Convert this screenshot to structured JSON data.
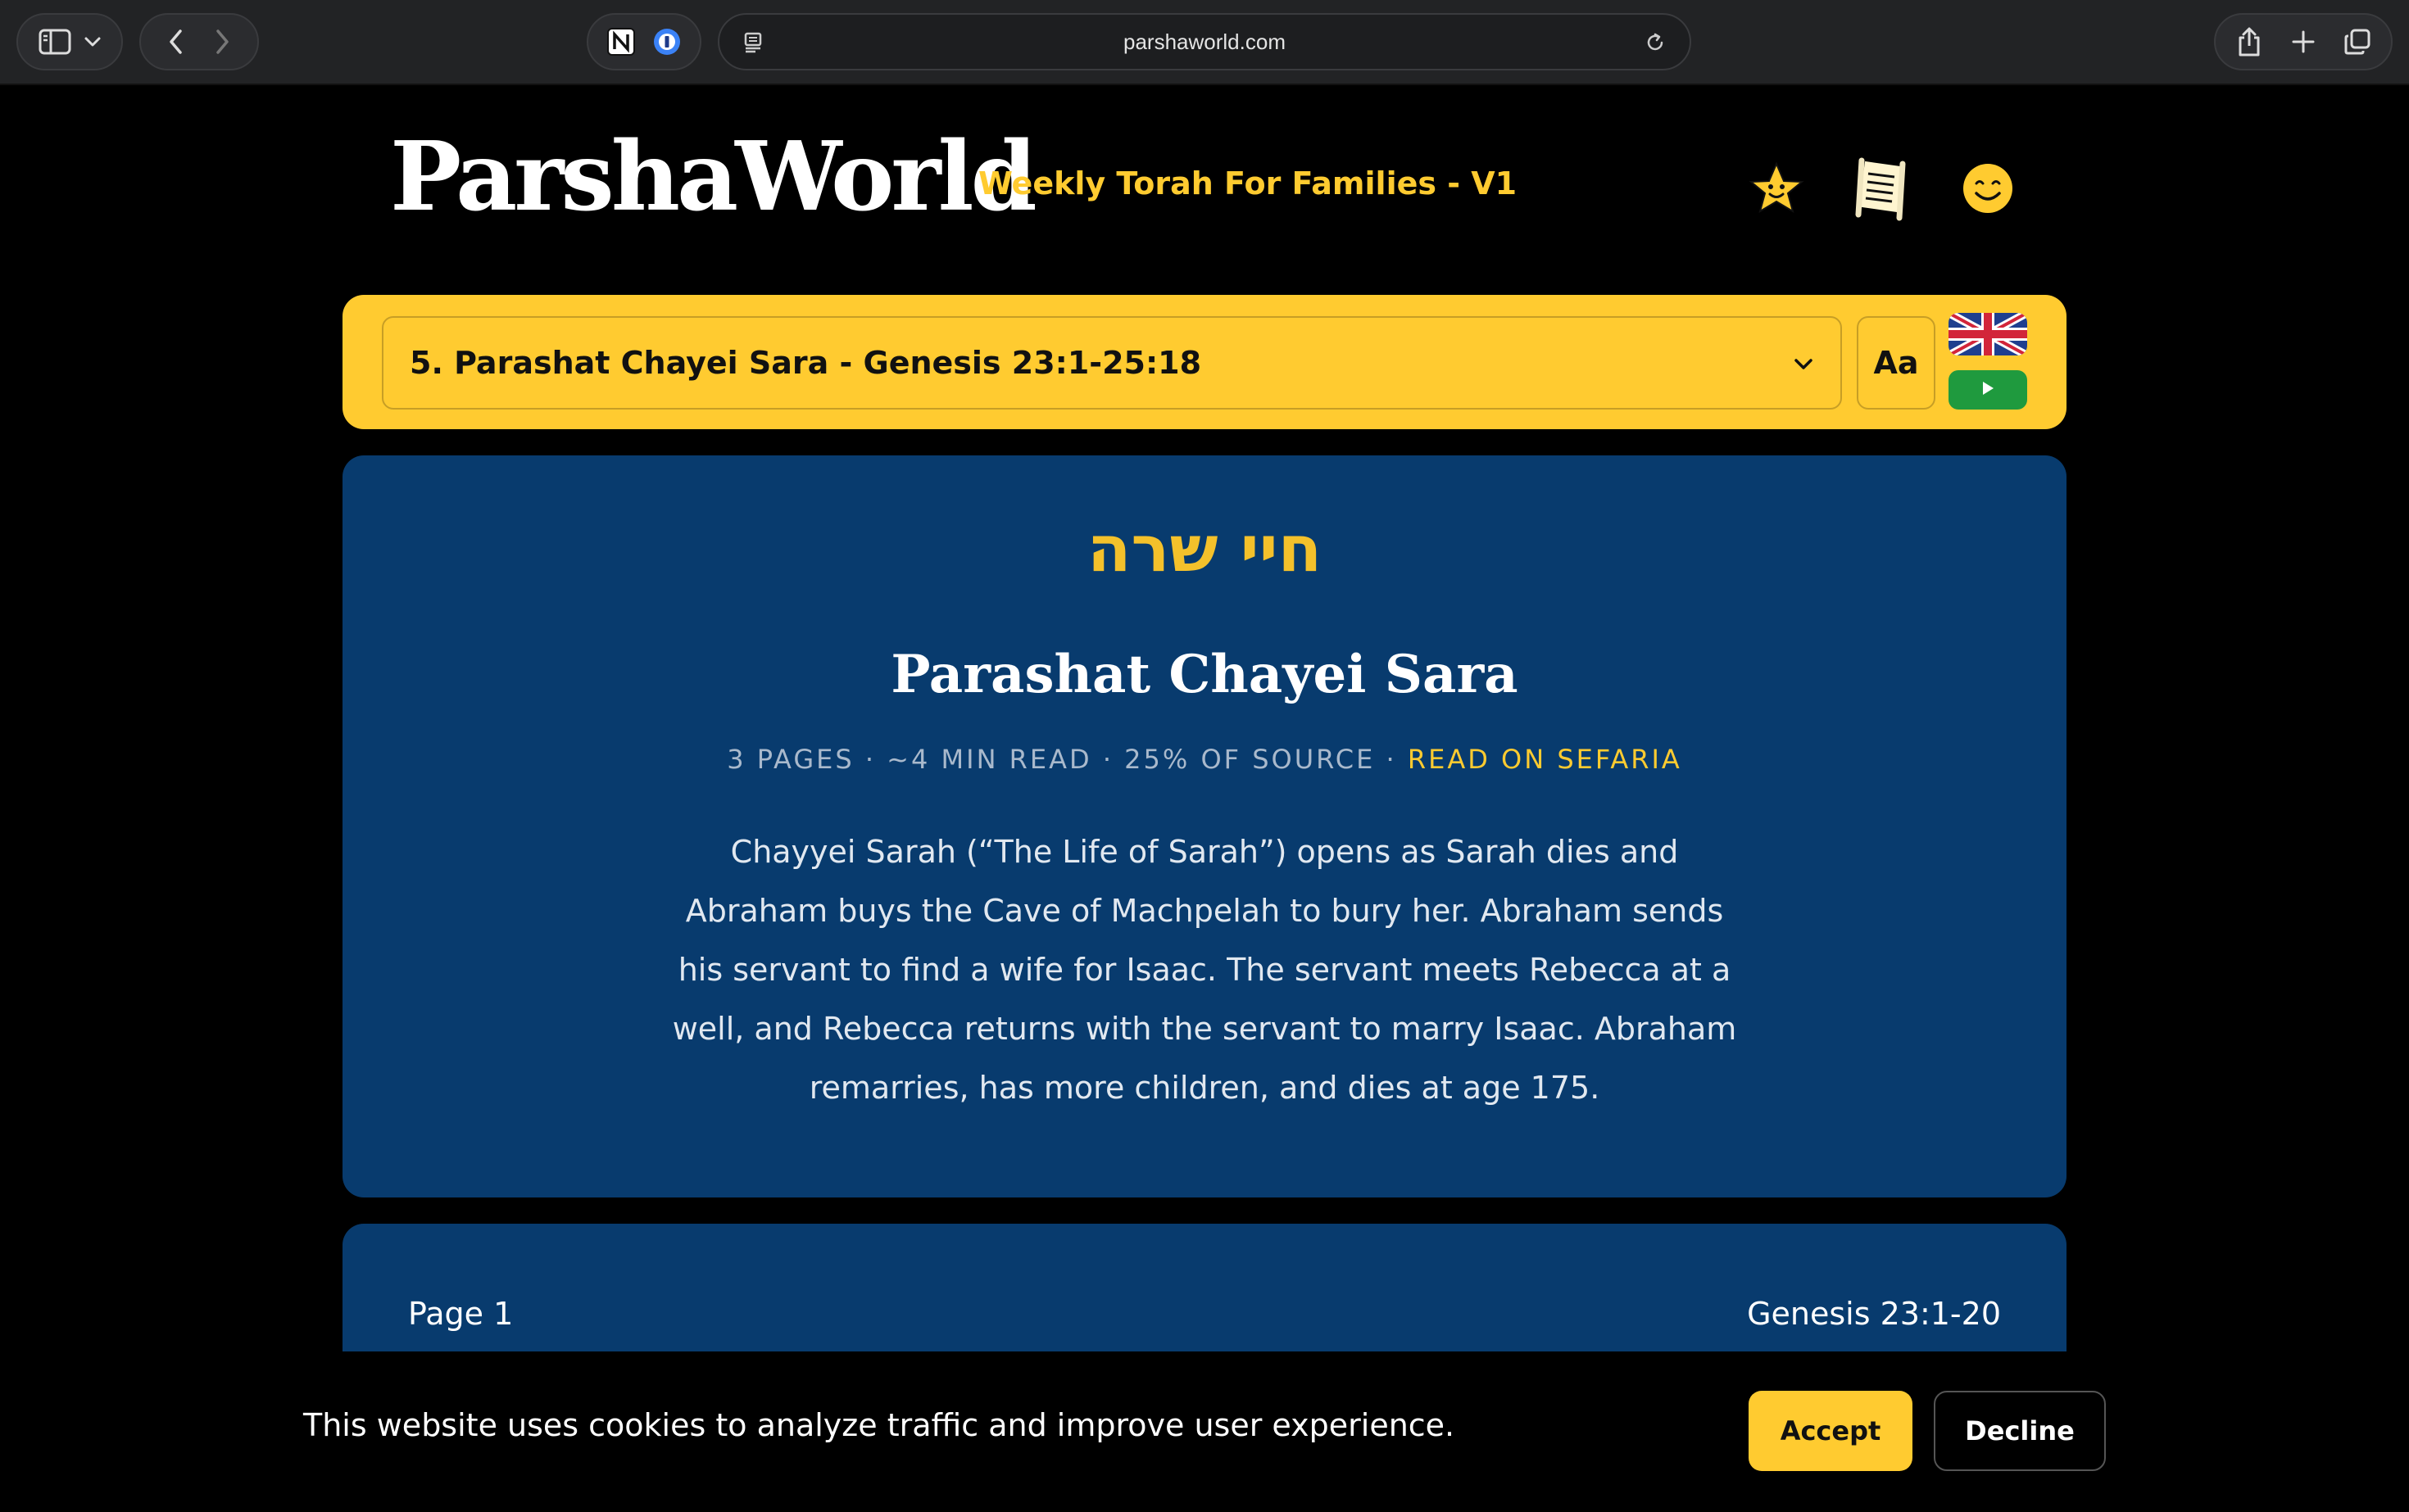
{
  "browser": {
    "url": "parshaworld.com"
  },
  "site": {
    "logo": "ParshaWorld",
    "tagline": "Weekly Torah For Families - V1"
  },
  "selector": {
    "selected": "5. Parashat Chayei Sara - Genesis 23:1-25:18",
    "font_button": "Aa"
  },
  "summary": {
    "hebrew_title": "חיי שרה",
    "title": "Parashat Chayei Sara",
    "meta_pages": "3 PAGES",
    "meta_read": "~4 MIN READ",
    "meta_source": "25% OF SOURCE",
    "meta_separator": " · ",
    "meta_link": "READ ON SEFARIA",
    "description": "Chayyei Sarah (“The Life of Sarah”) opens as Sarah dies and Abraham buys the Cave of Machpelah to bury her. Abraham sends his servant to find a wife for Isaac. The servant meets Rebecca at a well, and Rebecca returns with the servant to marry Isaac. Abraham remarries, has more children, and dies at age 175."
  },
  "page": {
    "label": "Page 1",
    "reference": "Genesis 23:1-20"
  },
  "cookie": {
    "message": "This website uses cookies to analyze traffic and improve user experience.",
    "accept_label": "Accept",
    "decline_label": "Decline"
  },
  "colors": {
    "accent_yellow": "#ffcb30",
    "card_blue": "#083b6e",
    "hebrew_gold": "#f4c12b",
    "play_green": "#1f9a3e"
  },
  "icons": {
    "header": [
      "star-face-icon",
      "torah-scroll-icon",
      "smiley-icon"
    ],
    "chrome": [
      "sidebar-icon",
      "chevron-down-icon",
      "back-icon",
      "forward-icon",
      "notion-icon",
      "password-manager-icon",
      "reader-icon",
      "reload-icon",
      "share-icon",
      "new-tab-icon",
      "tabs-overview-icon"
    ]
  }
}
